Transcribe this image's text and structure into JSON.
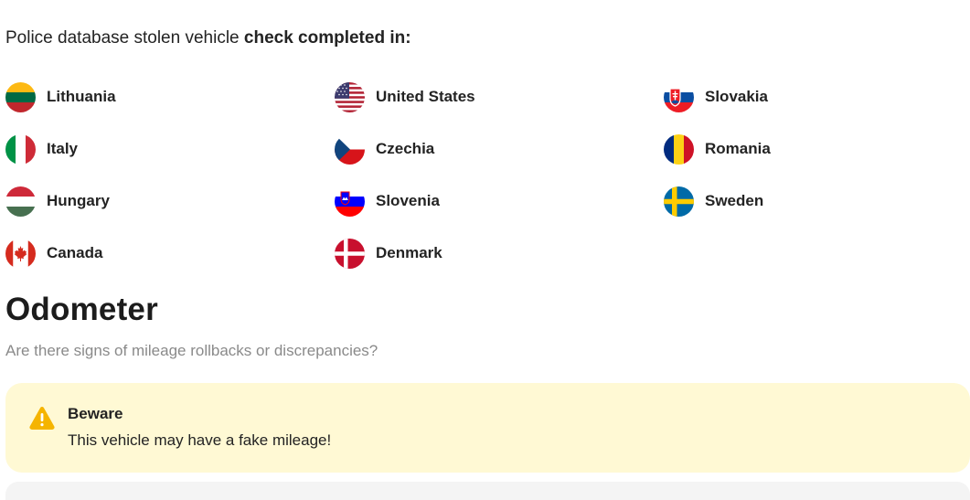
{
  "intro": {
    "prefix": "Police database stolen vehicle",
    "emphasis": "check completed in:"
  },
  "countries": [
    {
      "name": "Lithuania",
      "flag": "lithuania-flag-icon"
    },
    {
      "name": "United States",
      "flag": "united-states-flag-icon"
    },
    {
      "name": "Slovakia",
      "flag": "slovakia-flag-icon"
    },
    {
      "name": "Italy",
      "flag": "italy-flag-icon"
    },
    {
      "name": "Czechia",
      "flag": "czechia-flag-icon"
    },
    {
      "name": "Romania",
      "flag": "romania-flag-icon"
    },
    {
      "name": "Hungary",
      "flag": "hungary-flag-icon"
    },
    {
      "name": "Slovenia",
      "flag": "slovenia-flag-icon"
    },
    {
      "name": "Sweden",
      "flag": "sweden-flag-icon"
    },
    {
      "name": "Canada",
      "flag": "canada-flag-icon"
    },
    {
      "name": "Denmark",
      "flag": "denmark-flag-icon"
    }
  ],
  "odometer": {
    "title": "Odometer",
    "subtitle": "Are there signs of mileage rollbacks or discrepancies?"
  },
  "alert": {
    "icon": "warning-icon",
    "title": "Beware",
    "message": "This vehicle may have a fake mileage!",
    "background_color": "#fff9d4",
    "icon_color": "#f5b400"
  }
}
